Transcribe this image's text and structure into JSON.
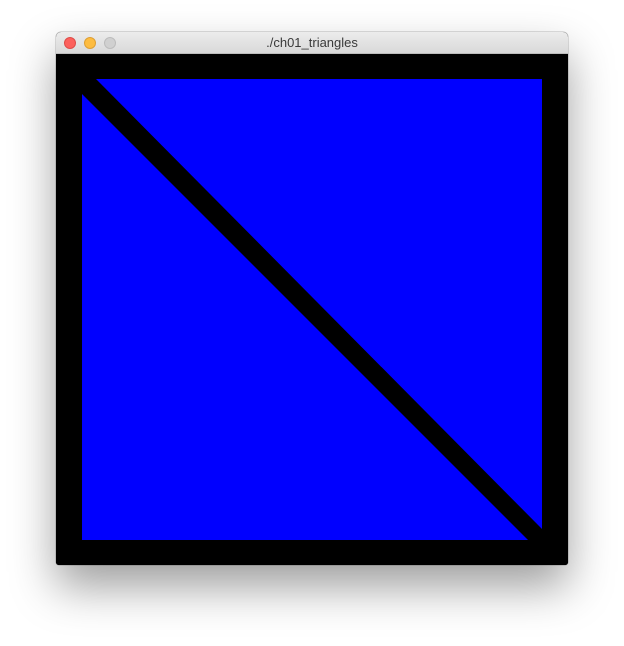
{
  "window": {
    "title": "./ch01_triangles",
    "controls": {
      "close": "close-button",
      "minimize": "minimize-button",
      "zoom": "zoom-button"
    }
  },
  "scene": {
    "background_color": "#000000",
    "triangle_fill_color": "#0000ff",
    "triangle_count": 2
  }
}
